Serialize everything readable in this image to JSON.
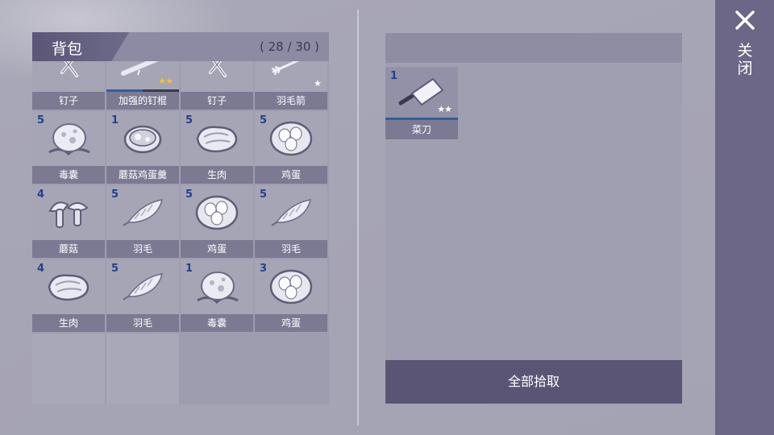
{
  "backpack": {
    "title": "背包",
    "count": "( 28 / 30 )",
    "items": [
      {
        "name": "钉子",
        "qty": "",
        "icon": "nail-icon"
      },
      {
        "name": "加强的钉棍",
        "qty": "",
        "icon": "spiked-club-icon",
        "stars": "★★",
        "star_color": "gold",
        "durability": 0.5
      },
      {
        "name": "钉子",
        "qty": "",
        "icon": "nail-icon"
      },
      {
        "name": "羽毛箭",
        "qty": "",
        "icon": "feather-arrow-icon",
        "stars": "★",
        "star_color": "white"
      },
      {
        "name": "毒囊",
        "qty": "5",
        "icon": "poison-sac-icon"
      },
      {
        "name": "蘑菇鸡蛋羹",
        "qty": "1",
        "icon": "mushroom-egg-soup-icon"
      },
      {
        "name": "生肉",
        "qty": "5",
        "icon": "raw-meat-icon"
      },
      {
        "name": "鸡蛋",
        "qty": "5",
        "icon": "eggs-icon"
      },
      {
        "name": "蘑菇",
        "qty": "4",
        "icon": "mushroom-icon"
      },
      {
        "name": "羽毛",
        "qty": "5",
        "icon": "feather-icon"
      },
      {
        "name": "鸡蛋",
        "qty": "5",
        "icon": "eggs-icon"
      },
      {
        "name": "羽毛",
        "qty": "5",
        "icon": "feather-icon"
      },
      {
        "name": "生肉",
        "qty": "4",
        "icon": "raw-meat-icon"
      },
      {
        "name": "羽毛",
        "qty": "5",
        "icon": "feather-icon"
      },
      {
        "name": "毒囊",
        "qty": "1",
        "icon": "poison-sac-icon"
      },
      {
        "name": "鸡蛋",
        "qty": "3",
        "icon": "eggs-icon"
      }
    ],
    "empty_slots": 2
  },
  "loot": {
    "items": [
      {
        "name": "菜刀",
        "qty": "1",
        "icon": "cleaver-icon",
        "stars": "★★",
        "star_color": "white",
        "durability": 1.0
      }
    ],
    "take_all_label": "全部拾取"
  },
  "close": {
    "label": "关闭",
    "icon": "close-icon"
  },
  "colors": {
    "quantity_text": "#25408a",
    "durability_bar": "#2f5f9a",
    "gold_star": "#f4c13a"
  }
}
